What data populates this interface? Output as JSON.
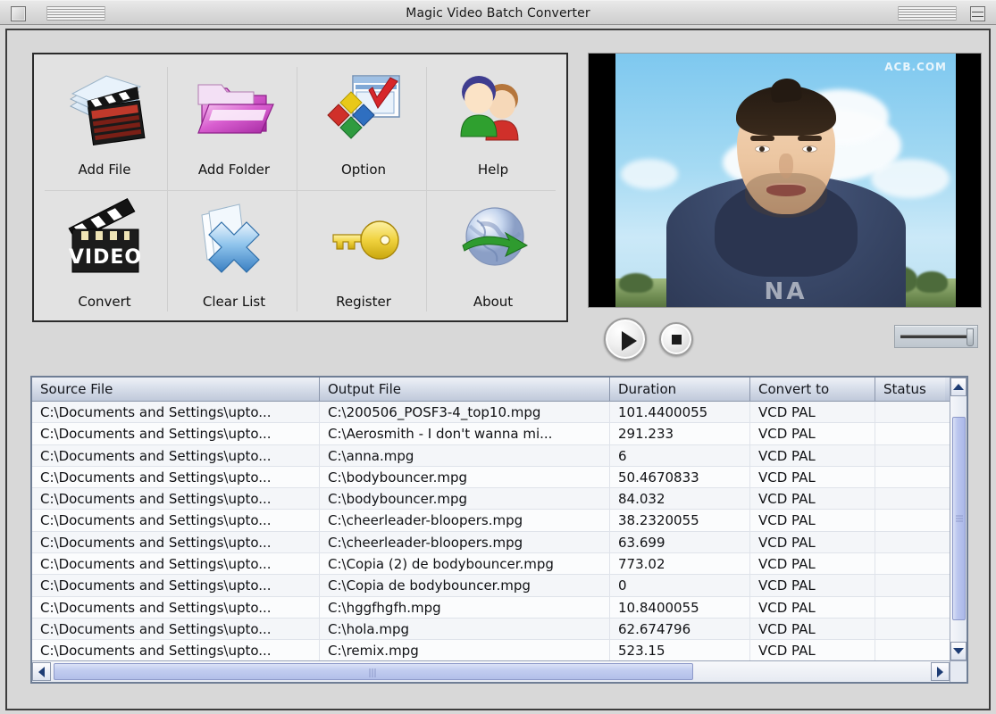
{
  "window": {
    "title": "Magic Video Batch Converter",
    "close_box": "close-box",
    "zoom_box": "zoom-box"
  },
  "toolbar": {
    "buttons": [
      {
        "label": "Add File",
        "icon": "add-file-icon"
      },
      {
        "label": "Add Folder",
        "icon": "add-folder-icon"
      },
      {
        "label": "Option",
        "icon": "option-icon"
      },
      {
        "label": "Help",
        "icon": "help-icon"
      },
      {
        "label": "Convert",
        "icon": "convert-icon"
      },
      {
        "label": "Clear List",
        "icon": "clear-list-icon"
      },
      {
        "label": "Register",
        "icon": "register-key-icon"
      },
      {
        "label": "About",
        "icon": "about-globe-icon"
      }
    ]
  },
  "preview": {
    "watermark": "ACB.COM",
    "shirt_text": "NA",
    "play_label": "play-icon",
    "stop_label": "stop-icon",
    "seek_value": "100"
  },
  "list": {
    "columns": [
      "Source File",
      "Output File",
      "Duration",
      "Convert to",
      "Status"
    ],
    "rows": [
      {
        "source": "C:\\Documents and Settings\\upto...",
        "output": "C:\\200506_POSF3-4_top10.mpg",
        "duration": "101.4400055",
        "convert_to": "VCD PAL",
        "status": ""
      },
      {
        "source": "C:\\Documents and Settings\\upto...",
        "output": "C:\\Aerosmith - I don't wanna mi...",
        "duration": "291.233",
        "convert_to": "VCD PAL",
        "status": ""
      },
      {
        "source": "C:\\Documents and Settings\\upto...",
        "output": "C:\\anna.mpg",
        "duration": "6",
        "convert_to": "VCD PAL",
        "status": ""
      },
      {
        "source": "C:\\Documents and Settings\\upto...",
        "output": "C:\\bodybouncer.mpg",
        "duration": "50.4670833",
        "convert_to": "VCD PAL",
        "status": ""
      },
      {
        "source": "C:\\Documents and Settings\\upto...",
        "output": "C:\\bodybouncer.mpg",
        "duration": "84.032",
        "convert_to": "VCD PAL",
        "status": ""
      },
      {
        "source": "C:\\Documents and Settings\\upto...",
        "output": "C:\\cheerleader-bloopers.mpg",
        "duration": "38.2320055",
        "convert_to": "VCD PAL",
        "status": ""
      },
      {
        "source": "C:\\Documents and Settings\\upto...",
        "output": "C:\\cheerleader-bloopers.mpg",
        "duration": "63.699",
        "convert_to": "VCD PAL",
        "status": ""
      },
      {
        "source": "C:\\Documents and Settings\\upto...",
        "output": "C:\\Copia (2) de bodybouncer.mpg",
        "duration": "773.02",
        "convert_to": "VCD PAL",
        "status": ""
      },
      {
        "source": "C:\\Documents and Settings\\upto...",
        "output": "C:\\Copia de bodybouncer.mpg",
        "duration": "0",
        "convert_to": "VCD PAL",
        "status": ""
      },
      {
        "source": "C:\\Documents and Settings\\upto...",
        "output": "C:\\hggfhgfh.mpg",
        "duration": "10.8400055",
        "convert_to": "VCD PAL",
        "status": ""
      },
      {
        "source": "C:\\Documents and Settings\\upto...",
        "output": "C:\\hola.mpg",
        "duration": "62.674796",
        "convert_to": "VCD PAL",
        "status": ""
      },
      {
        "source": "C:\\Documents and Settings\\upto...",
        "output": "C:\\remix.mpg",
        "duration": "523.15",
        "convert_to": "VCD PAL",
        "status": ""
      }
    ]
  },
  "scrollbars": {
    "v_up": "scroll-up-arrow",
    "v_down": "scroll-down-arrow",
    "h_left": "scroll-left-arrow",
    "h_right": "scroll-right-arrow"
  },
  "colors": {
    "window_bg": "#d8d8d8",
    "panel_bg": "#e2e2e2",
    "list_header": "#cfd7e6",
    "scroll_thumb": "#bcc7ef",
    "accent_blue": "#1d3c74"
  }
}
